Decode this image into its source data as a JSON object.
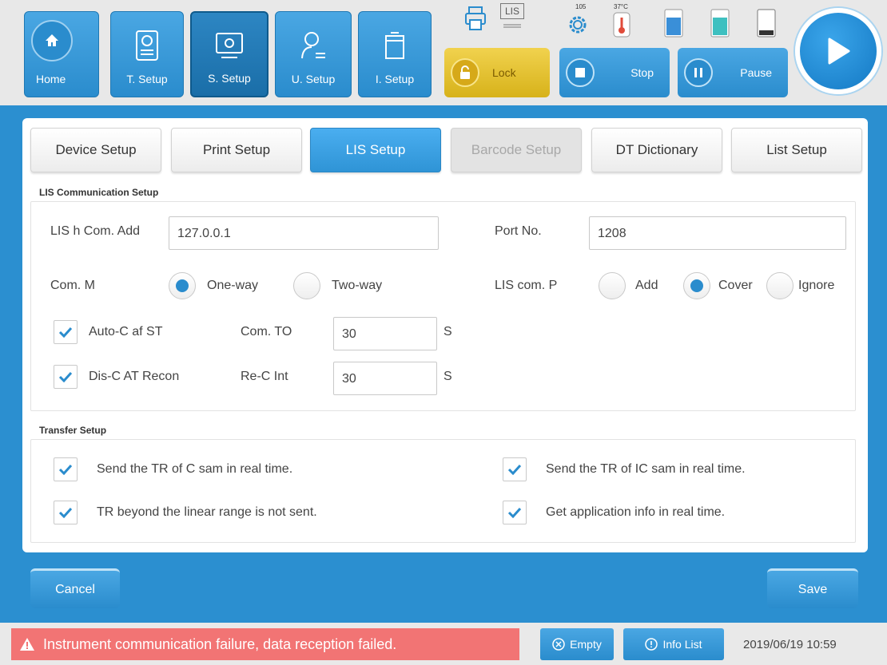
{
  "nav": {
    "home": "Home",
    "t_setup": "T. Setup",
    "s_setup": "S. Setup",
    "u_setup": "U. Setup",
    "i_setup": "I. Setup"
  },
  "status": {
    "lis_label": "LIS",
    "gear_value": "105",
    "temperature": "37°C"
  },
  "controls": {
    "lock": "Lock",
    "stop": "Stop",
    "pause": "Pause"
  },
  "tabs": [
    {
      "label": "Device Setup",
      "state": "normal"
    },
    {
      "label": "Print Setup",
      "state": "normal"
    },
    {
      "label": "LIS Setup",
      "state": "active"
    },
    {
      "label": "Barcode Setup",
      "state": "disabled"
    },
    {
      "label": "DT Dictionary",
      "state": "normal"
    },
    {
      "label": "List Setup",
      "state": "normal"
    }
  ],
  "lis": {
    "section_title": "LIS Communication Setup",
    "host_label": "LIS h Com. Add",
    "host_value": "127.0.0.1",
    "port_label": "Port No.",
    "port_value": "1208",
    "mode_label": "Com. M",
    "mode_oneway": "One-way",
    "mode_twoway": "Two-way",
    "mode_selected": "One-way",
    "policy_label": "LIS com. P",
    "policy_add": "Add",
    "policy_cover": "Cover",
    "policy_ignore": "Ignore",
    "policy_selected": "Cover",
    "auto_connect": "Auto-C af ST",
    "disconnect": "Dis-C AT Recon",
    "timeout_label": "Com. TO",
    "timeout_value": "30",
    "timeout_unit": "S",
    "reconnect_label": "Re-C Int",
    "reconnect_value": "30",
    "reconnect_unit": "S"
  },
  "transfer": {
    "section_title": "Transfer Setup",
    "opt1": "Send the TR of C sam in real time.",
    "opt2": "Send the TR of IC sam in real time.",
    "opt3": "TR beyond the linear range is not sent.",
    "opt4": "Get application info in real time."
  },
  "footer": {
    "cancel": "Cancel",
    "save": "Save"
  },
  "statusbar": {
    "alert": "Instrument communication failure, data reception failed.",
    "empty": "Empty",
    "info_list": "Info List",
    "datetime": "2019/06/19 10:59"
  },
  "colors": {
    "accent": "#2a8ccd",
    "frame": "#2b8fd0",
    "alert": "#f27474",
    "lock": "#d7b21a"
  }
}
